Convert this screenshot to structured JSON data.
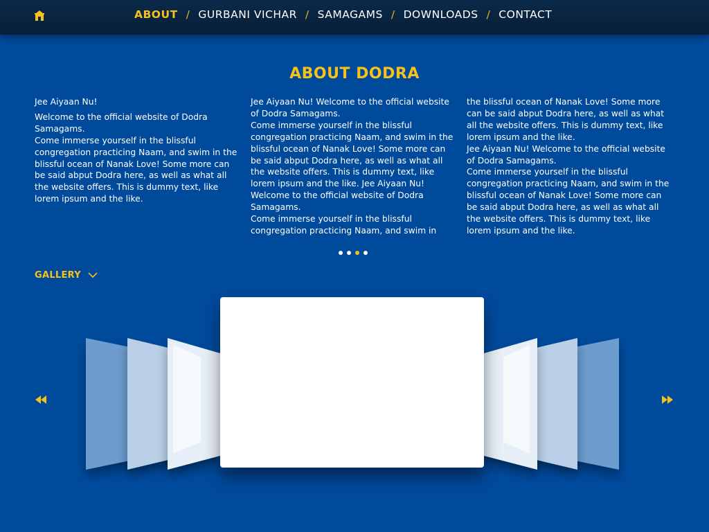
{
  "nav": {
    "home_icon": "home-icon",
    "items": [
      {
        "label": "ABOUT",
        "active": true
      },
      {
        "label": "GURBANI VICHAR",
        "active": false
      },
      {
        "label": "SAMAGAMS",
        "active": false
      },
      {
        "label": "DOWNLOADS",
        "active": false
      },
      {
        "label": "CONTACT",
        "active": false
      }
    ],
    "separator": "/"
  },
  "about": {
    "title": "ABOUT DODRA",
    "col1": {
      "greeting": "Jee Aiyaan Nu!",
      "body": "Welcome to the official website of Dodra Samagams.\nCome immerse yourself in the blissful congregation practicing Naam, and swim in the blissful ocean of Nanak Love! Some more can be said abput Dodra here, as well as what all the website offers. This is dummy text, like lorem ipsum and the like."
    },
    "col2": {
      "body": "Jee Aiyaan Nu! Welcome to the official website of Dodra Samagams.\nCome immerse yourself in the blissful congregation practicing Naam, and swim in the blissful ocean of Nanak Love! Some more can be said abput Dodra here, as well as what all the website offers. This is dummy text, like lorem ipsum and the like. Jee Aiyaan Nu! Welcome to the official website of Dodra Samagams.\nCome immerse yourself in the blissful congregation practicing Naam, and swim in"
    },
    "col3": {
      "body": "the blissful ocean of Nanak Love! Some more can be said abput Dodra here, as well as what all the website offers. This is dummy text, like lorem ipsum and the like.\nJee Aiyaan Nu! Welcome to the official website of Dodra Samagams.\nCome immerse yourself in the blissful congregation practicing Naam, and swim in the blissful ocean of Nanak Love! Some more can be said abput Dodra here, as well as what all the website offers. This is dummy text, like lorem ipsum and the like."
    },
    "pager": {
      "count": 4,
      "active_index": 2
    }
  },
  "gallery": {
    "label": "GALLERY",
    "toggle_icon": "chevron-down-icon",
    "prev_icon": "rewind-icon",
    "next_icon": "fast-forward-icon"
  },
  "colors": {
    "background": "#004a9c",
    "topbar": "#0b2a4a",
    "accent": "#f6c11b",
    "text": "#ffffff"
  }
}
